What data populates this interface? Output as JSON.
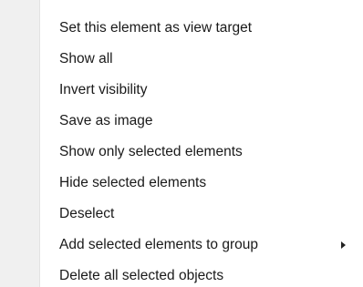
{
  "menu": {
    "items": [
      {
        "label": "Set this element as view target",
        "has_submenu": false
      },
      {
        "label": "Show all",
        "has_submenu": false
      },
      {
        "label": "Invert visibility",
        "has_submenu": false
      },
      {
        "label": "Save as image",
        "has_submenu": false
      },
      {
        "label": "Show only selected elements",
        "has_submenu": false
      },
      {
        "label": "Hide selected elements",
        "has_submenu": false
      },
      {
        "label": "Deselect",
        "has_submenu": false
      },
      {
        "label": "Add selected elements to group",
        "has_submenu": true,
        "submenu_icon": "submenu-arrow-icon"
      },
      {
        "label": "Delete all selected objects",
        "has_submenu": false
      }
    ]
  },
  "colors": {
    "background": "#ffffff",
    "gutter": "#f0f0f0",
    "text": "#1a1a1a"
  }
}
